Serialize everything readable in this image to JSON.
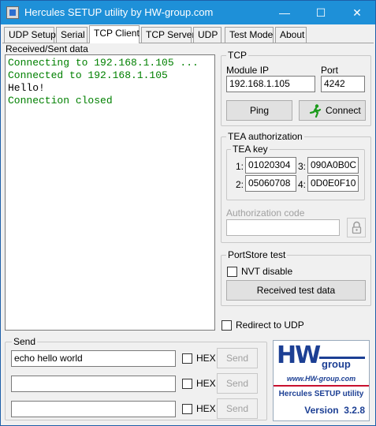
{
  "window": {
    "title": "Hercules SETUP utility by HW-group.com",
    "minimize": "—",
    "maximize": "☐",
    "close": "✕"
  },
  "tabs": [
    {
      "label": "UDP Setup"
    },
    {
      "label": "Serial"
    },
    {
      "label": "TCP Client",
      "active": true
    },
    {
      "label": "TCP Server"
    },
    {
      "label": "UDP"
    },
    {
      "label": "Test Mode"
    },
    {
      "label": "About"
    }
  ],
  "received": {
    "label": "Received/Sent data",
    "lines": [
      {
        "text": "Connecting to 192.168.1.105 ...",
        "color": "#008000"
      },
      {
        "text": "Connected to 192.168.1.105",
        "color": "#008000"
      },
      {
        "text": "Hello!",
        "color": "#000000"
      },
      {
        "text": "Connection closed",
        "color": "#008000"
      }
    ]
  },
  "tcp": {
    "title": "TCP",
    "module_ip_label": "Module IP",
    "module_ip": "192.168.1.105",
    "port_label": "Port",
    "port": "4242",
    "ping_label": "Ping",
    "connect_label": "Connect"
  },
  "tea": {
    "title": "TEA authorization",
    "key_title": "TEA key",
    "keys": [
      {
        "label": "1:",
        "value": "01020304"
      },
      {
        "label": "3:",
        "value": "090A0B0C"
      },
      {
        "label": "2:",
        "value": "05060708"
      },
      {
        "label": "4:",
        "value": "0D0E0F10"
      }
    ],
    "auth_code_label": "Authorization code",
    "auth_code_value": ""
  },
  "portstore": {
    "title": "PortStore test",
    "nvt_label": "NVT disable",
    "received_test_label": "Received test data"
  },
  "redirect": {
    "label": "Redirect to UDP"
  },
  "send": {
    "title": "Send",
    "rows": [
      {
        "value": "echo hello world",
        "hex_label": "HEX",
        "send_label": "Send"
      },
      {
        "value": "",
        "hex_label": "HEX",
        "send_label": "Send"
      },
      {
        "value": "",
        "hex_label": "HEX",
        "send_label": "Send"
      }
    ]
  },
  "logo": {
    "brand_hw": "HW",
    "brand_group": "group",
    "url": "www.HW-group.com",
    "product": "Hercules SETUP utility",
    "version": "Version  3.2.8",
    "colors": {
      "blue": "#1c3f94",
      "red": "#c8102e"
    }
  }
}
